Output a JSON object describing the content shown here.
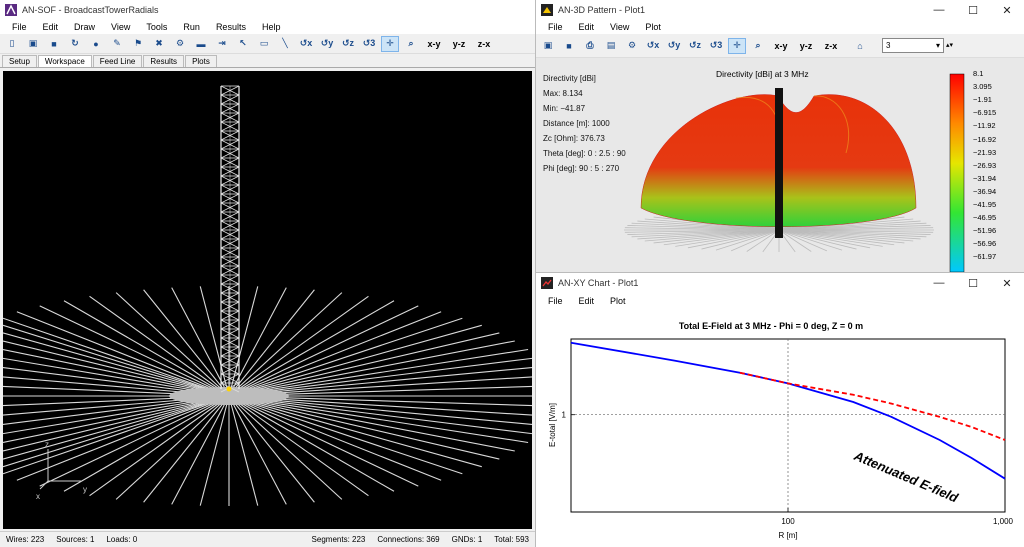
{
  "main": {
    "title": "AN-SOF - BroadcastTowerRadials",
    "menu": [
      "File",
      "Edit",
      "Draw",
      "View",
      "Tools",
      "Run",
      "Results",
      "Help"
    ],
    "toolbar_icons": [
      "new-file-icon",
      "open-folder-icon",
      "save-icon",
      "refresh-icon",
      "stop-icon",
      "pencil-icon",
      "stamp-icon",
      "delete-icon",
      "gear-icon",
      "comment-icon",
      "export-icon",
      "pointer-icon",
      "rectangle-icon",
      "line-icon",
      "rotate-x-icon",
      "rotate-y-icon",
      "rotate-z-icon",
      "rotate-3d-icon",
      "pan-icon",
      "zoom-icon"
    ],
    "view_labels": [
      "x-y",
      "y-z",
      "z-x"
    ],
    "tabs": [
      "Setup",
      "Workspace",
      "Feed Line",
      "Results",
      "Plots"
    ],
    "active_tab": "Workspace",
    "axes": {
      "z": "z",
      "x": "x",
      "y": "y"
    },
    "status": {
      "wires": "Wires: 223",
      "sources": "Sources: 1",
      "loads": "Loads: 0",
      "segments": "Segments: 223",
      "connections": "Connections: 369",
      "gnds": "GNDs: 1",
      "total": "Total: 593"
    },
    "colors": {
      "workspace_bg": "#000000",
      "wire": "#e6e6e6",
      "source": "#ffd400"
    }
  },
  "pattern3d": {
    "title": "AN-3D Pattern - Plot1",
    "menu": [
      "File",
      "Edit",
      "View",
      "Plot"
    ],
    "toolbar_icons": [
      "open-folder-icon",
      "save-icon",
      "print-icon",
      "clipboard-icon",
      "gear-icon",
      "rotate-x-icon",
      "rotate-y-icon",
      "rotate-z-icon",
      "rotate-3d-icon",
      "pan-icon",
      "zoom-icon"
    ],
    "view_labels": [
      "x-y",
      "y-z",
      "z-x"
    ],
    "home_icon": "home-icon",
    "frequency_select": "3",
    "plot_title": "Directivity [dBi] at 3 MHz",
    "info": [
      "Directivity [dBi]",
      "Max: 8.134",
      "Min: −41.87",
      "Distance [m]: 1000",
      "Zc [Ohm]: 376.73",
      "Theta [deg]: 0 : 2.5 : 90",
      "Phi [deg]: 90 : 5 : 270"
    ],
    "colorbar_labels": [
      "8.1",
      "3.095",
      "−1.91",
      "−6.915",
      "−11.92",
      "−16.92",
      "−21.93",
      "−26.93",
      "−31.94",
      "−36.94",
      "−41.95",
      "−46.95",
      "−51.96",
      "−56.96",
      "−61.97"
    ]
  },
  "xychart": {
    "title": "AN-XY Chart - Plot1",
    "menu": [
      "File",
      "Edit",
      "Plot"
    ],
    "chart_data": {
      "type": "line",
      "title": "Total E-Field at 3 MHz - Phi = 0 deg, Z = 0 m",
      "xlabel": "R [m]",
      "ylabel": "E-total [V/m]",
      "x_scale": "log",
      "y_scale": "log",
      "xlim": [
        10,
        1000
      ],
      "ylim": [
        0.1,
        6
      ],
      "x_tick_labels": [
        "100",
        "1,000"
      ],
      "y_tick_labels": [
        "1"
      ],
      "series": [
        {
          "color": "#0000ff",
          "style": "solid",
          "x": [
            10,
            30,
            60,
            100,
            200,
            300,
            500,
            700,
            1000
          ],
          "y": [
            5.5,
            3.6,
            2.7,
            2.1,
            1.35,
            0.95,
            0.55,
            0.36,
            0.22
          ]
        },
        {
          "color": "#ff0000",
          "style": "dashed",
          "x": [
            60,
            100,
            200,
            300,
            500,
            700,
            1000
          ],
          "y": [
            2.7,
            2.1,
            1.6,
            1.3,
            0.95,
            0.75,
            0.55
          ]
        }
      ],
      "annotations": [
        {
          "text": "Attenuated E-field"
        }
      ],
      "grid": true
    }
  }
}
